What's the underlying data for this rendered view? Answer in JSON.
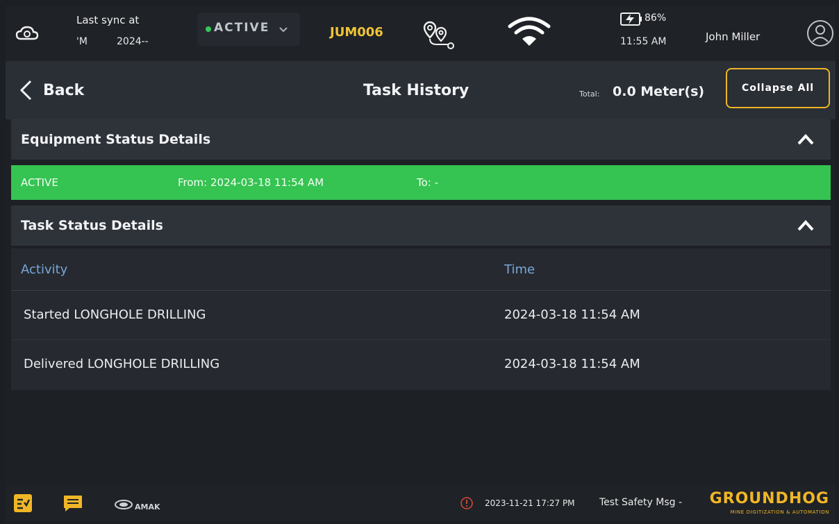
{
  "topbar": {
    "sync_label": "Last sync at",
    "sync_time": "'M",
    "sync_date": "2024-‐",
    "status": "ACTIVE",
    "equipment_id": "JUM006",
    "battery_pct": "86%",
    "clock": "11:55 AM",
    "username": "John Miller",
    "colors": {
      "status_dot": "#35c95a",
      "equipment_id": "#f0c43a"
    }
  },
  "header": {
    "back_label": "Back",
    "title": "Task History",
    "total_label": "Total:",
    "total_value": "0.0 Meter(s)",
    "collapse_label": "Collapse All"
  },
  "equipment_section": {
    "title": "Equipment Status Details",
    "row": {
      "status": "ACTIVE",
      "from": "From: 2024-03-18 11:54 AM",
      "to": "To: -",
      "color": "#35c352"
    }
  },
  "task_section": {
    "title": "Task Status Details",
    "columns": [
      "Activity",
      "Time"
    ],
    "rows": [
      {
        "activity": "Started LONGHOLE DRILLING",
        "time": "2024-03-18 11:54 AM"
      },
      {
        "activity": "Delivered LONGHOLE DRILLING",
        "time": "2024-03-18 11:54 AM"
      }
    ]
  },
  "bottombar": {
    "amak_logo_text": "AMAK",
    "safety_date": "2023-11-21 17:27 PM",
    "safety_msg": "Test Safety Msg -",
    "brand": "GROUNDHOG",
    "brand_sub": "MINE DIGITIZATION & AUTOMATION",
    "brand_color": "#f0b627"
  }
}
